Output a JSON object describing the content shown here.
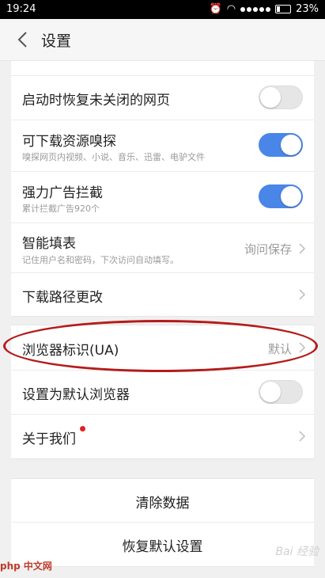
{
  "status_bar": {
    "time": "19:24",
    "battery": "23%"
  },
  "header": {
    "title": "设置"
  },
  "settings": {
    "restore_tabs": {
      "label": "启动时恢复未关闭的网页",
      "on": false
    },
    "resource_sniff": {
      "label": "可下载资源嗅探",
      "sub": "嗅探网页内视频、小说、音乐、迅雷、电驴文件",
      "on": true
    },
    "ad_block": {
      "label": "强力广告拦截",
      "sub": "累计拦截广告920个",
      "on": true
    },
    "autofill": {
      "label": "智能填表",
      "sub": "记住用户名和密码，下次访问自动填写。",
      "value": "询问保存"
    },
    "download_path": {
      "label": "下载路径更改"
    },
    "user_agent": {
      "label": "浏览器标识(UA)",
      "value": "默认"
    },
    "default_browser": {
      "label": "设置为默认浏览器",
      "on": false
    },
    "about": {
      "label": "关于我们"
    }
  },
  "actions": {
    "clear_data": "清除数据",
    "restore_defaults": "恢复默认设置"
  },
  "watermarks": {
    "php": "php 中文网",
    "baidu": "Bai 经验"
  },
  "colors": {
    "toggle_on": "#4a86e8",
    "annotation": "#b51b1b",
    "badge": "#e02020"
  }
}
